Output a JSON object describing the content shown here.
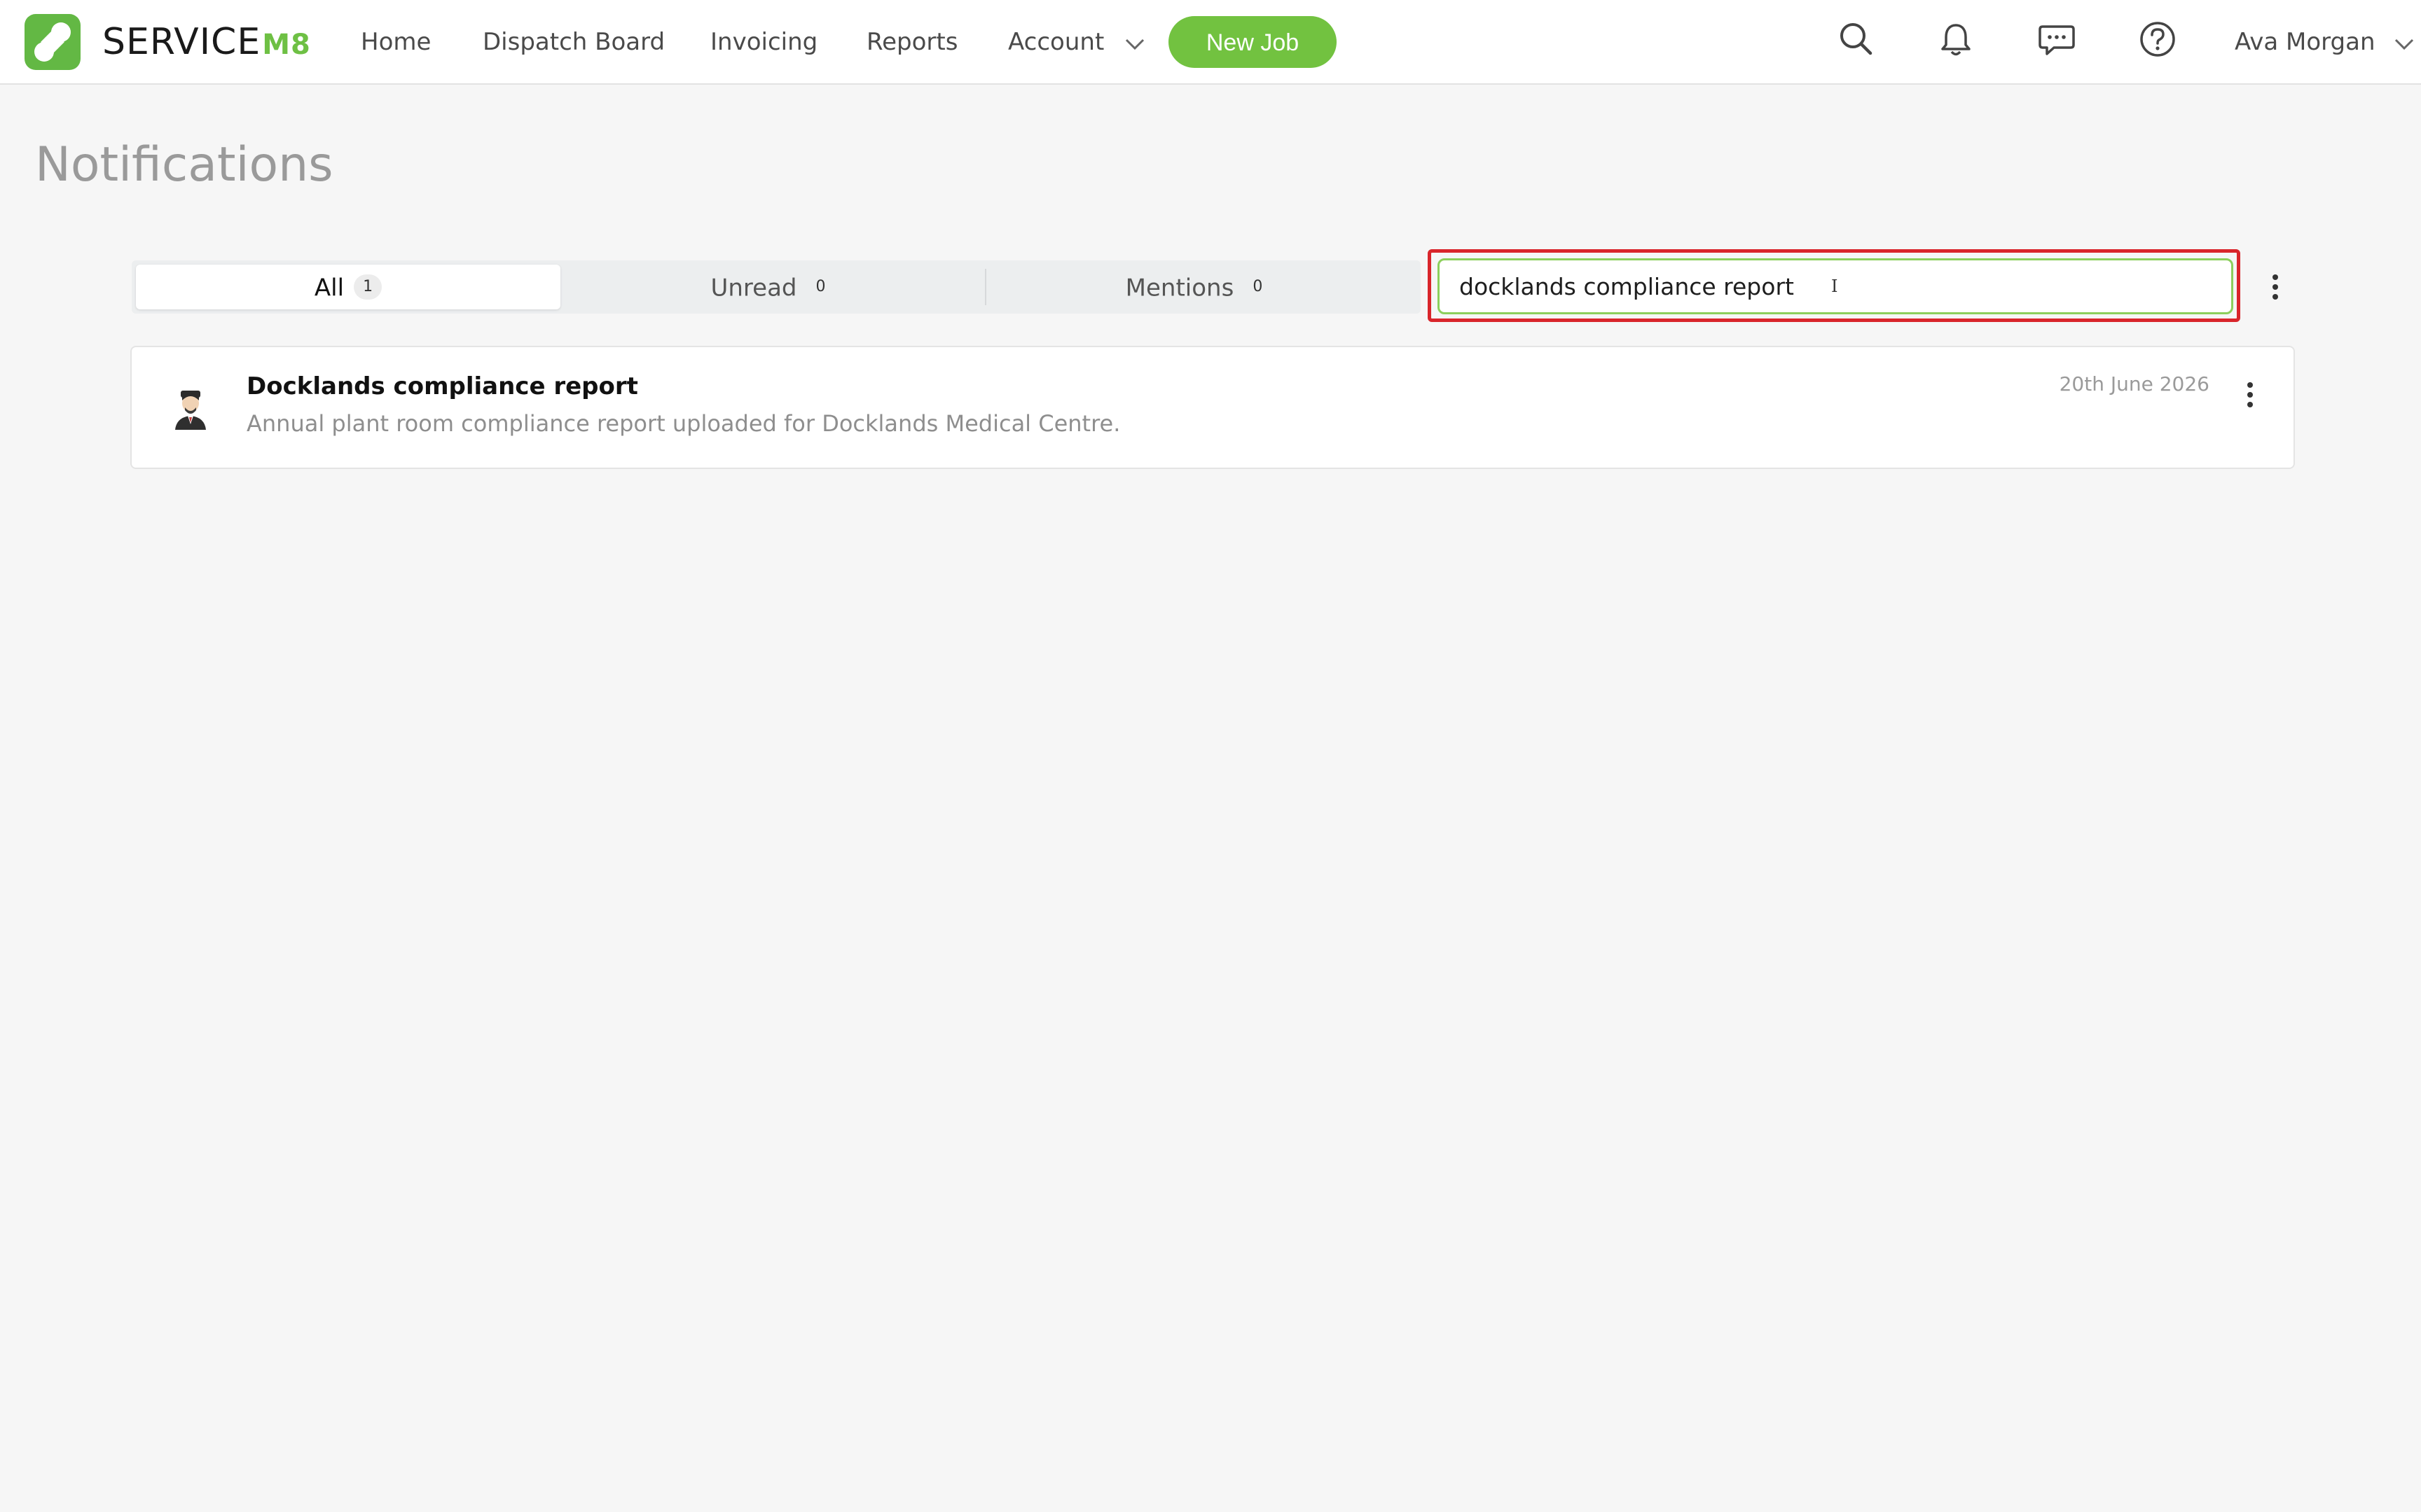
{
  "brand": {
    "logo_text": "SERVICE",
    "logo_suffix": "M8",
    "accent_color": "#72c240"
  },
  "nav": {
    "items": [
      {
        "label": "Home"
      },
      {
        "label": "Dispatch Board"
      },
      {
        "label": "Invoicing"
      },
      {
        "label": "Reports"
      },
      {
        "label": "Account"
      }
    ],
    "new_job_label": "New Job",
    "icons": [
      "search-icon",
      "bell-icon",
      "chat-icon",
      "help-icon"
    ],
    "user_name": "Ava Morgan"
  },
  "page": {
    "title": "Notifications"
  },
  "tabs": [
    {
      "label": "All",
      "count": "1",
      "active": true
    },
    {
      "label": "Unread",
      "count": "0",
      "active": false
    },
    {
      "label": "Mentions",
      "count": "0",
      "active": false
    }
  ],
  "search": {
    "value": "docklands compliance report",
    "cursor_glyph": "I"
  },
  "notifications": [
    {
      "title": "Docklands compliance report",
      "body": "Annual plant room compliance report uploaded for Docklands Medical Centre.",
      "date": "20th June 2026",
      "avatar_icon": "person-avatar-icon"
    }
  ]
}
